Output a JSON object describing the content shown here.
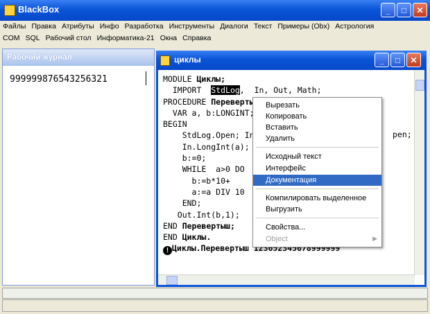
{
  "app": {
    "title": "BlackBox"
  },
  "window_buttons": {
    "minimize": "_",
    "maximize": "□",
    "close": "✕"
  },
  "menu": {
    "row1": [
      "Файлы",
      "Правка",
      "Атрибуты",
      "Инфо",
      "Разработка",
      "Инструменты",
      "Диалоги",
      "Текст",
      "Примеры (Obx)",
      "Астрология"
    ],
    "row2": [
      "COM",
      "SQL",
      "Рабочий стол",
      "Информатика-21",
      "Окна",
      "Справка"
    ]
  },
  "journal": {
    "title": "Рабочий журнал",
    "content": "999999876543256321"
  },
  "editor": {
    "title": "циклы",
    "code": {
      "l1a": "MODULE ",
      "l1b": "Циклы;",
      "l2a": "  IMPORT  ",
      "l2sel": "StdLog",
      "l2b": ",  In, Out, Math;",
      "l3a": "PROCEDURE ",
      "l3b": "Перевертыш*;",
      "l4": "  VAR a, b:LONGINT;",
      "l5": "BEGIN",
      "l6": "    StdLog.Open; In.Open;",
      "l6b": "pen;",
      "l7": "    In.LongInt(a);",
      "l8": "    b:=0;",
      "l9": "    WHILE  a>0 DO",
      "l10": "      b:=b*10+",
      "l11": "      a:=a DIV 10",
      "l12": "    END;",
      "l13": "   Out.Int(b,1);",
      "l14a": "END ",
      "l14b": "Перевертыш;",
      "l15a": "END ",
      "l15b": "Циклы.",
      "l16": "Циклы.Перевертыш 123652345678999999"
    }
  },
  "context_menu": {
    "cut": "Вырезать",
    "copy": "Копировать",
    "paste": "Вставить",
    "delete": "Удалить",
    "source": "Исходный текст",
    "interface": "Интерфейс",
    "documentation": "Документация",
    "compile_selection": "Компилировать выделенное",
    "unload": "Выгрузить",
    "properties": "Свойства...",
    "object": "Object"
  },
  "colors": {
    "titlebar": "#0a54d8",
    "highlight": "#316ac5",
    "background": "#ece9d8"
  }
}
